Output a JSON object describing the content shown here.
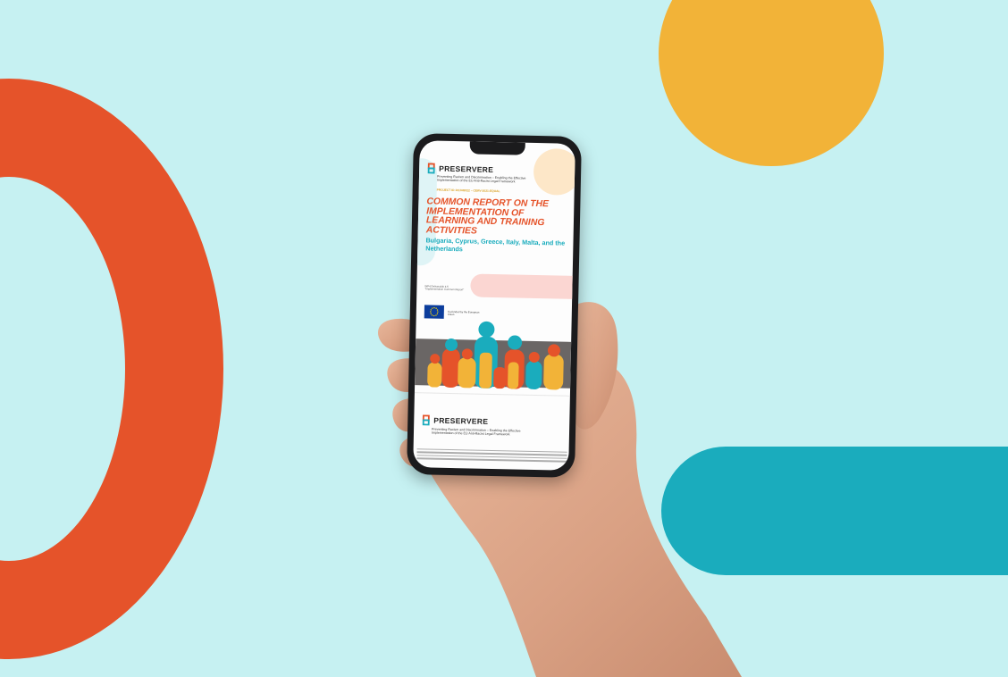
{
  "brand": "PRESERVERE",
  "subtitle_line": "Preventing Racism and Discrimination – Enabling the Effective Implementation of the EU Anti-Racist Legal Framework",
  "project_code": "PROJECT ID 101049322 – CERV-2021-EQUAL",
  "report_title": "COMMON REPORT ON THE IMPLEMENTATION OF LEARNING AND TRAINING ACTIVITIES",
  "countries": "Bulgaria, Cyprus, Greece, Italy, Malta, and the Netherlands",
  "deliverable": "WP4 Deliverable 4.5 \"Implementation Common Report\"",
  "eu_funding": "Co-funded by the European Union",
  "colors": {
    "background": "#c6f1f2",
    "orange": "#e5532a",
    "yellow": "#f2b338",
    "teal": "#1aacbd"
  }
}
